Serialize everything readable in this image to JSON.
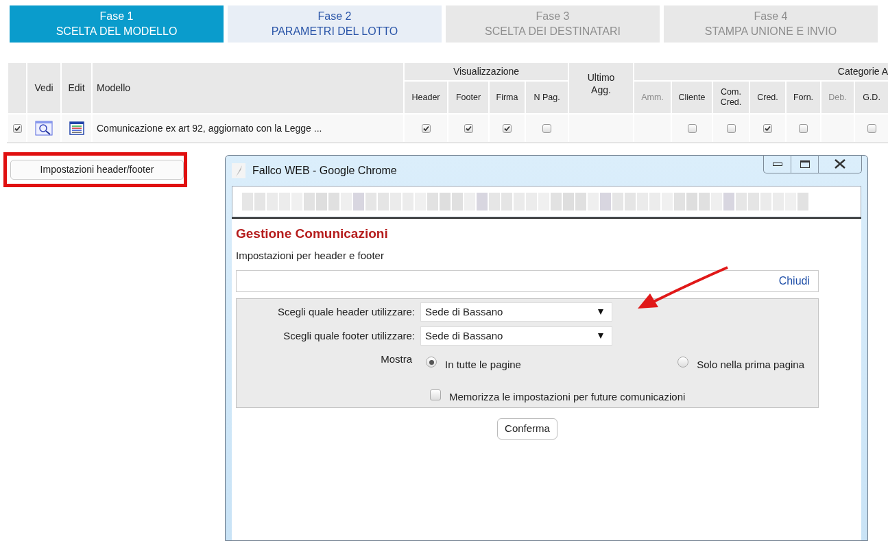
{
  "steps": [
    {
      "title": "Fase 1",
      "subtitle": "SCELTA DEL MODELLO",
      "selected": true,
      "disabled": false
    },
    {
      "title": "Fase 2",
      "subtitle": "PARAMETRI DEL LOTTO",
      "selected": false,
      "disabled": false
    },
    {
      "title": "Fase 3",
      "subtitle": "SCELTA DEI DESTINATARI",
      "selected": false,
      "disabled": true
    },
    {
      "title": "Fase 4",
      "subtitle": "STAMPA UNIONE E INVIO",
      "selected": false,
      "disabled": true
    }
  ],
  "table": {
    "columns": [
      {},
      {
        "label": "Vedi"
      },
      {
        "label": "Edit"
      },
      {
        "label": "Modello"
      },
      {
        "label": "Visualizzazione",
        "children": [
          {
            "label": "Header",
            "disabled": false
          },
          {
            "label": "Footer",
            "disabled": false
          },
          {
            "label": "Firma",
            "disabled": false
          },
          {
            "label": "N Pag.",
            "disabled": false
          }
        ]
      },
      {
        "label": "Ultimo Agg."
      },
      {
        "label": "Categorie A",
        "children": [
          {
            "label": "Amm.",
            "disabled": true
          },
          {
            "label": "Cliente",
            "disabled": false
          },
          {
            "label": "Com. Cred.",
            "disabled": false
          },
          {
            "label": "Cred.",
            "disabled": false
          },
          {
            "label": "Forn.",
            "disabled": false
          },
          {
            "label": "Deb.",
            "disabled": true
          },
          {
            "label": "G.D.",
            "disabled": false
          }
        ]
      }
    ],
    "rows": [
      {
        "checked": true,
        "model": "Comunicazione ex art 92, aggiornato con la Legge ...",
        "cells": [
          {
            "kind": "checkbox",
            "checked": true
          },
          {
            "kind": "checkbox",
            "checked": true
          },
          {
            "kind": "checkbox",
            "checked": true
          },
          {
            "kind": "checkbox",
            "checked": false
          },
          {
            "kind": "empty"
          },
          {
            "kind": "empty"
          },
          {
            "kind": "checkbox",
            "checked": false
          },
          {
            "kind": "checkbox",
            "checked": false
          },
          {
            "kind": "checkbox",
            "checked": true
          },
          {
            "kind": "checkbox",
            "checked": false
          },
          {
            "kind": "empty"
          },
          {
            "kind": "checkbox",
            "checked": false
          }
        ]
      }
    ]
  },
  "settings_button": "Impostazioni header/footer",
  "popup": {
    "window_title": "Fallco WEB - Google Chrome",
    "heading": "Gestione Comunicazioni",
    "subtitle": "Impostazioni per header e footer",
    "close_link": "Chiudi",
    "fields": [
      {
        "label": "Scegli quale header utilizzare:",
        "value": "Sede di Bassano"
      },
      {
        "label": "Scegli quale footer utilizzare:",
        "value": "Sede di Bassano"
      }
    ],
    "radio_label": "Mostra",
    "radio_options": [
      {
        "label": "In tutte le pagine",
        "selected": true
      },
      {
        "label": "Solo nella prima pagina",
        "selected": false
      }
    ],
    "remember": {
      "label": "Memorizza le impostazioni per future comunicazioni",
      "checked": false
    },
    "confirm_button": "Conferma"
  }
}
